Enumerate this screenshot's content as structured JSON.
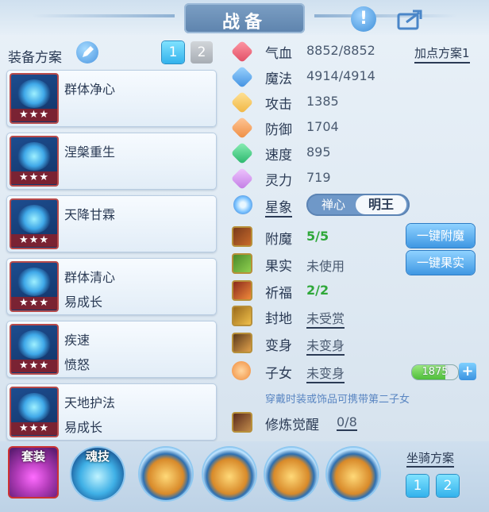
{
  "title": "战备",
  "left": {
    "plan_label": "装备方案",
    "plan_buttons": [
      "1",
      "2"
    ],
    "skills": [
      {
        "name": "群体净心",
        "sub": "",
        "stars": "★★★"
      },
      {
        "name": "涅槃重生",
        "sub": "",
        "stars": "★★★"
      },
      {
        "name": "天降甘霖",
        "sub": "",
        "stars": "★★★"
      },
      {
        "name": "群体清心",
        "sub": "易成长",
        "stars": "★★★"
      },
      {
        "name": "疾速",
        "sub": "愤怒",
        "stars": "★★★"
      },
      {
        "name": "天地护法",
        "sub": "易成长",
        "stars": "★★★"
      }
    ]
  },
  "stats": {
    "hp": {
      "label": "气血",
      "value": "8852/8852"
    },
    "mp": {
      "label": "魔法",
      "value": "4914/4914"
    },
    "atk": {
      "label": "攻击",
      "value": "1385"
    },
    "def": {
      "label": "防御",
      "value": "1704"
    },
    "spd": {
      "label": "速度",
      "value": "895"
    },
    "spirit": {
      "label": "灵力",
      "value": "719"
    },
    "point_plan": "加点方案1"
  },
  "xingxiang": {
    "label": "星象",
    "option_a": "禅心",
    "option_b": "明王",
    "selected": "明王"
  },
  "extra": {
    "enchant": {
      "label": "附魔",
      "value": "5/5",
      "button": "一键附魔"
    },
    "fruit": {
      "label": "果实",
      "value": "未使用",
      "button": "一键果实"
    },
    "blessing": {
      "label": "祈福",
      "value": "2/2"
    },
    "fief": {
      "label": "封地",
      "value": "未受赏"
    },
    "transform": {
      "label": "变身",
      "value": "未变身"
    },
    "children": {
      "label": "子女",
      "value": "未变身",
      "progress_text": "1875",
      "progress_fraction": 0.72,
      "plus": "+"
    },
    "hint": "穿戴时装或饰品可携带第二子女",
    "cultivation": {
      "label": "修炼觉醒",
      "value": "0/8"
    }
  },
  "bottom": {
    "suit_label": "套装",
    "soul_label": "魂技",
    "mount_label": "坐骑方案",
    "mount_buttons": [
      "1",
      "2"
    ]
  },
  "colors": {
    "accent": "#3f97e3",
    "green": "#2fa83a",
    "hint": "#5a86c2"
  }
}
